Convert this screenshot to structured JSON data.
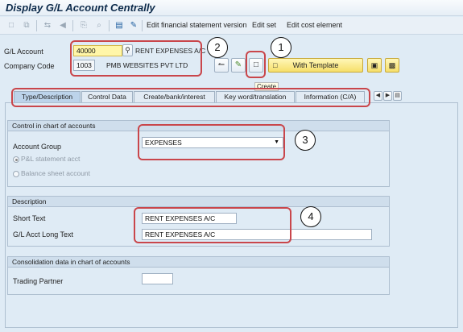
{
  "window": {
    "title": "Display G/L Account Centrally"
  },
  "toolbar": {
    "icons": [
      "create-icon",
      "copy-icon",
      "other-object-icon",
      "prev-icon",
      "save-icon"
    ],
    "menu": [
      "Edit financial statement version",
      "Edit set",
      "Edit cost element"
    ]
  },
  "header": {
    "gl_account_label": "G/L Account",
    "gl_account_value": "40000",
    "gl_account_desc": "RENT EXPENSES A/C",
    "company_code_label": "Company Code",
    "company_code_value": "1003",
    "company_name": "PMB WEBSITES PVT LTD",
    "with_template_label": "With Template",
    "create_tooltip": "Create"
  },
  "tabs": [
    {
      "label": "Type/Description",
      "active": true
    },
    {
      "label": "Control Data",
      "active": false
    },
    {
      "label": "Create/bank/interest",
      "active": false
    },
    {
      "label": "Key word/translation",
      "active": false
    },
    {
      "label": "Information (C/A)",
      "active": false
    }
  ],
  "control_group": {
    "title": "Control in chart of accounts",
    "account_group_label": "Account Group",
    "account_group_value": "EXPENSES",
    "pl_label": "P&L statement acct",
    "bs_label": "Balance sheet account",
    "pl_selected": true
  },
  "description_group": {
    "title": "Description",
    "short_text_label": "Short Text",
    "short_text_value": "RENT EXPENSES A/C",
    "long_text_label": "G/L Acct Long Text",
    "long_text_value": "RENT EXPENSES A/C"
  },
  "consolidation_group": {
    "title": "Consolidation data in chart of accounts",
    "trading_partner_label": "Trading Partner",
    "trading_partner_value": ""
  },
  "annotations": [
    "1",
    "2",
    "3",
    "4"
  ],
  "colors": {
    "highlight": "#c9464b",
    "field_yellow": "#fff6a8",
    "button_yellow": "#f6df6a",
    "background": "#dfebf5"
  }
}
